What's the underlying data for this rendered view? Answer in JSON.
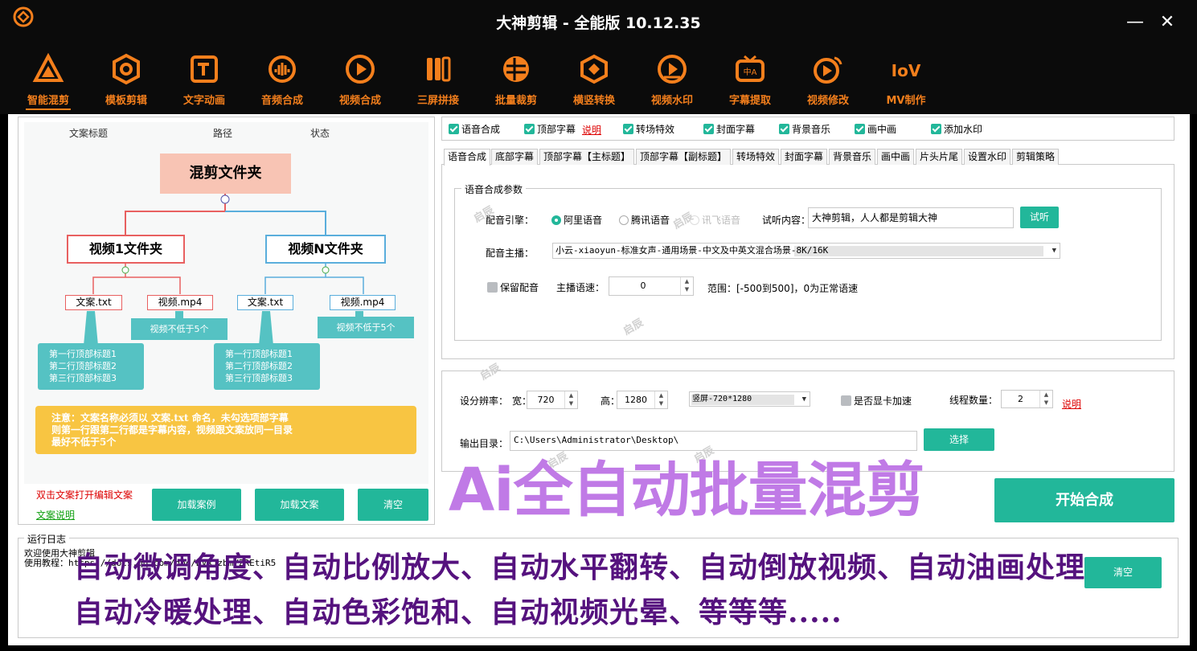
{
  "window": {
    "title": "大神剪辑 - 全能版 10.12.35",
    "minimize_glyph": "—",
    "close_glyph": "✕"
  },
  "toolbar": {
    "items": [
      {
        "label": "智能混剪",
        "icon": "triangle-icon"
      },
      {
        "label": "模板剪辑",
        "icon": "hexagon-icon"
      },
      {
        "label": "文字动画",
        "icon": "text-frame-icon"
      },
      {
        "label": "音频合成",
        "icon": "audio-globe-icon"
      },
      {
        "label": "视频合成",
        "icon": "play-circle-icon"
      },
      {
        "label": "三屏拼接",
        "icon": "three-bars-icon"
      },
      {
        "label": "批量裁剪",
        "icon": "crop-circle-icon"
      },
      {
        "label": "横竖转换",
        "icon": "rotate-icon"
      },
      {
        "label": "视频水印",
        "icon": "watermark-icon"
      },
      {
        "label": "字幕提取",
        "icon": "subtitle-tv-icon"
      },
      {
        "label": "视频修改",
        "icon": "edit-video-icon"
      },
      {
        "label": "MV制作",
        "icon": "mv-icon"
      }
    ],
    "accent": "#f47f1c"
  },
  "left": {
    "columns": [
      "文案标题",
      "路径",
      "状态"
    ],
    "mindmap": {
      "root": "混剪文件夹",
      "folder1": "视频1文件夹",
      "folderN": "视频N文件夹",
      "txt1": "文案.txt",
      "mp41": "视频.mp4",
      "txt2": "文案.txt",
      "mp42": "视频.mp4",
      "min1": "视频不低于5个",
      "min2": "视频不低于5个",
      "lines1": [
        "第一行顶部标题1",
        "第二行顶部标题2",
        "第三行顶部标题3"
      ],
      "lines2": [
        "第一行顶部标题1",
        "第二行顶部标题2",
        "第三行顶部标题3"
      ]
    },
    "note": [
      "注意：文案名称必须以 文案.txt 命名，未勾选项部字幕",
      "则第一行跟第二行都是字幕内容，视频跟文案放同一目录",
      "最好不低于5个"
    ],
    "dbl_click_hint": "双击文案打开编辑文案",
    "doc_link": "文案说明",
    "btn_load_case": "加载案例",
    "btn_load_text": "加载文案",
    "btn_clear": "清空"
  },
  "options": {
    "checks": [
      "语音合成",
      "顶部字幕",
      "转场特效",
      "封面字幕",
      "背景音乐",
      "画中画",
      "添加水印"
    ],
    "explain": "说明"
  },
  "tabs": [
    "语音合成",
    "底部字幕",
    "顶部字幕【主标题】",
    "顶部字幕【副标题】",
    "转场特效",
    "封面字幕",
    "背景音乐",
    "画中画",
    "片头片尾",
    "设置水印",
    "剪辑策略"
  ],
  "voice": {
    "group_title": "语音合成参数",
    "engine_label": "配音引擎：",
    "engines": [
      "阿里语音",
      "腾讯语音",
      "讯飞语音"
    ],
    "preview_label": "试听内容：",
    "preview_text": "大神剪辑，人人都是剪辑大神",
    "preview_btn": "试听",
    "anchor_label": "配音主播：",
    "anchor_value": "小云-xiaoyun-标准女声-通用场景-中文及中英文混合场景-8K/16K",
    "keep_label": "保留配音",
    "speed_label": "主播语速：",
    "speed_value": "0",
    "range_text": "范围：[-500到500]，0为正常语速"
  },
  "output": {
    "res_label": "设分辨率：",
    "width_label": "宽：",
    "width_value": "720",
    "height_label": "高：",
    "height_value": "1280",
    "preset": "竖屏-720*1280",
    "gpu_label": "是否显卡加速",
    "threads_label": "线程数量：",
    "threads_value": "2",
    "explain": "说明",
    "dir_label": "输出目录：",
    "dir_value": "C:\\Users\\Administrator\\Desktop\\",
    "browse_btn": "选择"
  },
  "start_btn": "开始合成",
  "log": {
    "title": "运行日志",
    "line1": "欢迎使用大神剪辑",
    "line2": "使用教程：https://docs.qq.com/doc/DVRJzbmYZREtiR5",
    "clear_btn": "清空"
  },
  "watermark": "启辰",
  "overlay": {
    "headline": "Ai全自动批量混剪",
    "line1": "自动微调角度、自动比例放大、自动水平翻转、自动倒放视频、自动油画处理",
    "line2": "自动冷暖处理、自动色彩饱和、自动视频光晕、等等等....."
  }
}
